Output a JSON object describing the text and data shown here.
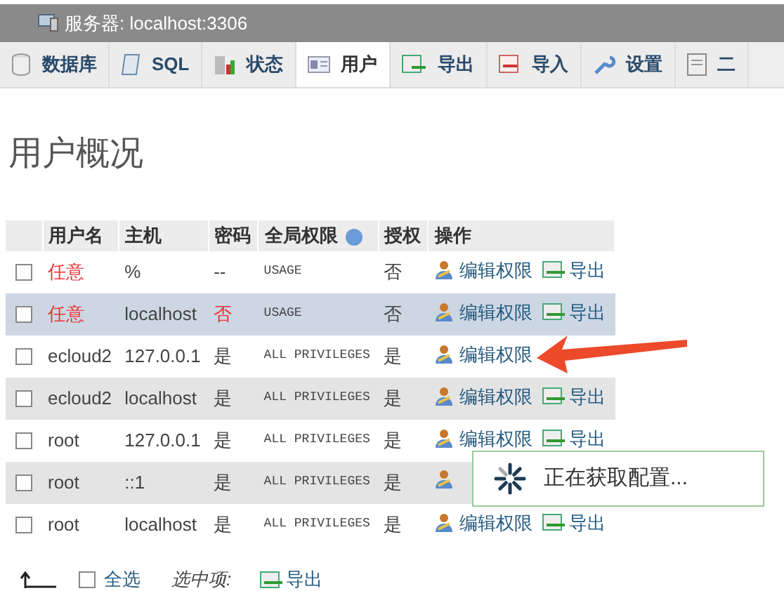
{
  "window": {
    "title": "服务器: localhost:3306"
  },
  "tabs": [
    {
      "label": "数据库",
      "selected": false
    },
    {
      "label": "SQL",
      "selected": false
    },
    {
      "label": "状态",
      "selected": false
    },
    {
      "label": "用户",
      "selected": true
    },
    {
      "label": "导出",
      "selected": false
    },
    {
      "label": "导入",
      "selected": false
    },
    {
      "label": "设置",
      "selected": false
    },
    {
      "label": "二",
      "selected": false
    }
  ],
  "heading": "用户概况",
  "table": {
    "columns": [
      "用户名",
      "主机",
      "密码",
      "全局权限",
      "授权",
      "操作"
    ],
    "rows": [
      {
        "user": "任意",
        "anonymous": true,
        "host": "%",
        "password": "--",
        "password_missing": false,
        "privileges": "USAGE",
        "grant": "否",
        "selected": false,
        "checked": false,
        "edit": "编辑权限",
        "export": "导出"
      },
      {
        "user": "任意",
        "anonymous": true,
        "host": "localhost",
        "password": "否",
        "password_missing": true,
        "privileges": "USAGE",
        "grant": "否",
        "selected": true,
        "checked": false,
        "edit": "编辑权限",
        "export": "导出"
      },
      {
        "user": "ecloud2",
        "anonymous": false,
        "host": "127.0.0.1",
        "password": "是",
        "password_missing": false,
        "privileges": "ALL PRIVILEGES",
        "grant": "是",
        "selected": false,
        "checked": false,
        "edit": "编辑权限"
      },
      {
        "user": "ecloud2",
        "anonymous": false,
        "host": "localhost",
        "password": "是",
        "password_missing": false,
        "privileges": "ALL PRIVILEGES",
        "grant": "是",
        "selected": false,
        "checked": false,
        "edit": "编辑权限",
        "export": "导出"
      },
      {
        "user": "root",
        "anonymous": false,
        "host": "127.0.0.1",
        "password": "是",
        "password_missing": false,
        "privileges": "ALL PRIVILEGES",
        "grant": "是",
        "selected": false,
        "checked": false,
        "edit": "编辑权限",
        "export": "导出"
      },
      {
        "user": "root",
        "anonymous": false,
        "host": "::1",
        "password": "是",
        "password_missing": false,
        "privileges": "ALL PRIVILEGES",
        "grant": "是",
        "selected": false,
        "checked": false
      },
      {
        "user": "root",
        "anonymous": false,
        "host": "localhost",
        "password": "是",
        "password_missing": false,
        "privileges": "ALL PRIVILEGES",
        "grant": "是",
        "selected": false,
        "checked": false,
        "edit": "编辑权限",
        "export": "导出"
      }
    ]
  },
  "footer": {
    "select_all": "全选",
    "select_all_checked": false,
    "with_selected": "选中项:",
    "export": "导出"
  },
  "popup": {
    "message": "正在获取配置..."
  }
}
